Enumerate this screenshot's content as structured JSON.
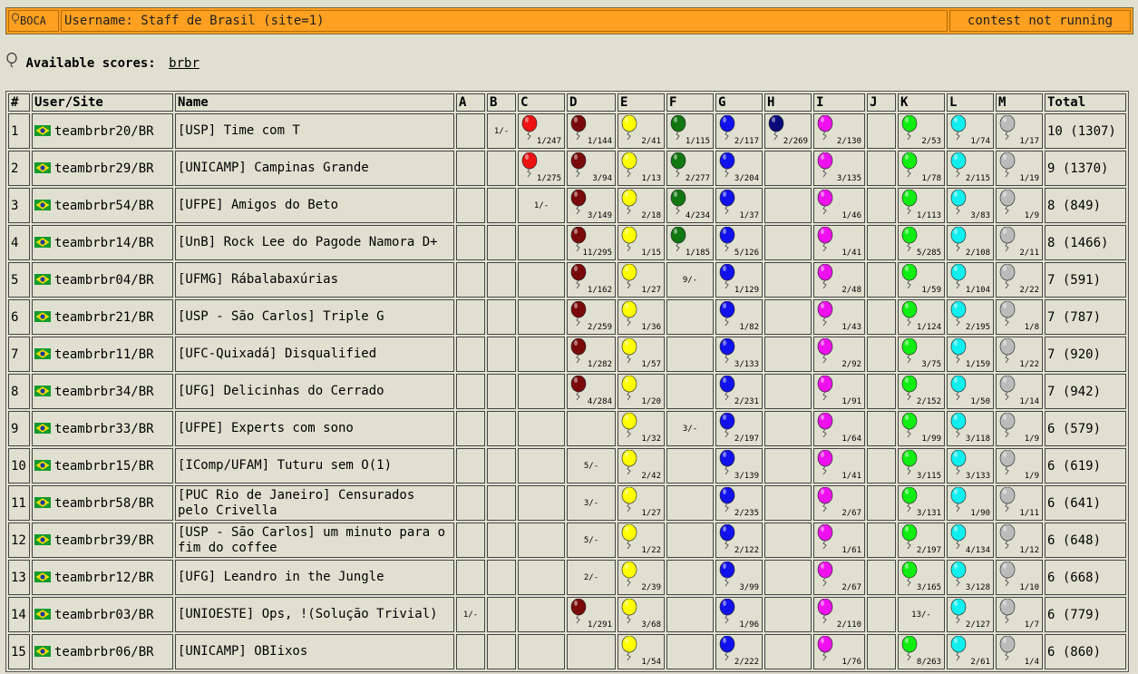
{
  "header": {
    "logo": "BOCA",
    "username": "Username: Staff de Brasil (site=1)",
    "status": "contest not running"
  },
  "scores": {
    "label": "Available scores:",
    "link": "brbr"
  },
  "columns": [
    "#",
    "User/Site",
    "Name",
    "A",
    "B",
    "C",
    "D",
    "E",
    "F",
    "G",
    "H",
    "I",
    "J",
    "K",
    "L",
    "M",
    "Total"
  ],
  "colors": {
    "C": "#ee1111",
    "D": "#7a0a0a",
    "E": "#ffff00",
    "F": "#117711",
    "G": "#1111ee",
    "H": "#0a0a7a",
    "I": "#ee11ee",
    "J": "#aaaaaa",
    "K": "#11ee11",
    "L": "#11eeee",
    "M": "#bbbbbb"
  },
  "rows": [
    {
      "rank": "1",
      "user": "teambrbr20/BR",
      "name": "[USP] Time com T",
      "cells": {
        "B": {
          "t": "1/-"
        },
        "C": {
          "v": "1/247"
        },
        "D": {
          "v": "1/144"
        },
        "E": {
          "v": "2/41"
        },
        "F": {
          "v": "1/115"
        },
        "G": {
          "v": "2/117"
        },
        "H": {
          "v": "2/269"
        },
        "I": {
          "v": "2/130"
        },
        "K": {
          "v": "2/53"
        },
        "L": {
          "v": "1/74"
        },
        "M": {
          "v": "1/17"
        }
      },
      "total": "10 (1307)"
    },
    {
      "rank": "2",
      "user": "teambrbr29/BR",
      "name": "[UNICAMP] Campinas Grande",
      "cells": {
        "C": {
          "v": "1/275"
        },
        "D": {
          "v": "3/94"
        },
        "E": {
          "v": "1/13"
        },
        "F": {
          "v": "2/277"
        },
        "G": {
          "v": "3/204"
        },
        "I": {
          "v": "3/135"
        },
        "K": {
          "v": "1/78"
        },
        "L": {
          "v": "2/115"
        },
        "M": {
          "v": "1/19"
        }
      },
      "total": "9 (1370)"
    },
    {
      "rank": "3",
      "user": "teambrbr54/BR",
      "name": "[UFPE] Amigos do Beto",
      "cells": {
        "C": {
          "t": "1/-"
        },
        "D": {
          "v": "3/149"
        },
        "E": {
          "v": "2/18"
        },
        "F": {
          "v": "4/234"
        },
        "G": {
          "v": "1/37"
        },
        "I": {
          "v": "1/46"
        },
        "K": {
          "v": "1/113"
        },
        "L": {
          "v": "3/83"
        },
        "M": {
          "v": "1/9"
        }
      },
      "total": "8 (849)"
    },
    {
      "rank": "4",
      "user": "teambrbr14/BR",
      "name": "[UnB] Rock Lee do Pagode Namora D+",
      "cells": {
        "D": {
          "v": "11/295"
        },
        "E": {
          "v": "1/15"
        },
        "F": {
          "v": "1/185"
        },
        "G": {
          "v": "5/126"
        },
        "I": {
          "v": "1/41"
        },
        "K": {
          "v": "5/285"
        },
        "L": {
          "v": "2/108"
        },
        "M": {
          "v": "2/11"
        }
      },
      "total": "8 (1466)"
    },
    {
      "rank": "5",
      "user": "teambrbr04/BR",
      "name": "[UFMG] Rábalabaxúrias",
      "cells": {
        "D": {
          "v": "1/162"
        },
        "E": {
          "v": "1/27"
        },
        "F": {
          "t": "9/-"
        },
        "G": {
          "v": "1/129"
        },
        "I": {
          "v": "2/48"
        },
        "K": {
          "v": "1/59"
        },
        "L": {
          "v": "1/104"
        },
        "M": {
          "v": "2/22"
        }
      },
      "total": "7 (591)"
    },
    {
      "rank": "6",
      "user": "teambrbr21/BR",
      "name": "[USP - São Carlos] Triple G",
      "cells": {
        "D": {
          "v": "2/259"
        },
        "E": {
          "v": "1/36"
        },
        "G": {
          "v": "1/82"
        },
        "I": {
          "v": "1/43"
        },
        "K": {
          "v": "1/124"
        },
        "L": {
          "v": "2/195"
        },
        "M": {
          "v": "1/8"
        }
      },
      "total": "7 (787)"
    },
    {
      "rank": "7",
      "user": "teambrbr11/BR",
      "name": "[UFC-Quixadá] Disqualified",
      "cells": {
        "D": {
          "v": "1/282"
        },
        "E": {
          "v": "1/57"
        },
        "G": {
          "v": "3/133"
        },
        "I": {
          "v": "2/92"
        },
        "K": {
          "v": "3/75"
        },
        "L": {
          "v": "1/159"
        },
        "M": {
          "v": "1/22"
        }
      },
      "total": "7 (920)"
    },
    {
      "rank": "8",
      "user": "teambrbr34/BR",
      "name": "[UFG] Delicinhas do Cerrado",
      "cells": {
        "D": {
          "v": "4/284"
        },
        "E": {
          "v": "1/20"
        },
        "G": {
          "v": "2/231"
        },
        "I": {
          "v": "1/91"
        },
        "K": {
          "v": "2/152"
        },
        "L": {
          "v": "1/50"
        },
        "M": {
          "v": "1/14"
        }
      },
      "total": "7 (942)"
    },
    {
      "rank": "9",
      "user": "teambrbr33/BR",
      "name": "[UFPE] Experts com sono",
      "cells": {
        "E": {
          "v": "1/32"
        },
        "F": {
          "t": "3/-"
        },
        "G": {
          "v": "2/197"
        },
        "I": {
          "v": "1/64"
        },
        "K": {
          "v": "1/99"
        },
        "L": {
          "v": "3/118"
        },
        "M": {
          "v": "1/9"
        }
      },
      "total": "6 (579)"
    },
    {
      "rank": "10",
      "user": "teambrbr15/BR",
      "name": "[IComp/UFAM] Tuturu sem O(1)",
      "cells": {
        "D": {
          "t": "5/-"
        },
        "E": {
          "v": "2/42"
        },
        "G": {
          "v": "3/139"
        },
        "I": {
          "v": "1/41"
        },
        "K": {
          "v": "3/115"
        },
        "L": {
          "v": "3/133"
        },
        "M": {
          "v": "1/9"
        }
      },
      "total": "6 (619)"
    },
    {
      "rank": "11",
      "user": "teambrbr58/BR",
      "name": "[PUC Rio de Janeiro] Censurados pelo Crivella",
      "cells": {
        "D": {
          "t": "3/-"
        },
        "E": {
          "v": "1/27"
        },
        "G": {
          "v": "2/235"
        },
        "I": {
          "v": "2/67"
        },
        "K": {
          "v": "3/131"
        },
        "L": {
          "v": "1/90"
        },
        "M": {
          "v": "1/11"
        }
      },
      "total": "6 (641)"
    },
    {
      "rank": "12",
      "user": "teambrbr39/BR",
      "name": "[USP - São Carlos] um minuto para o fim do coffee",
      "cells": {
        "D": {
          "t": "5/-"
        },
        "E": {
          "v": "1/22"
        },
        "G": {
          "v": "2/122"
        },
        "I": {
          "v": "1/61"
        },
        "K": {
          "v": "2/197"
        },
        "L": {
          "v": "4/134"
        },
        "M": {
          "v": "1/12"
        }
      },
      "total": "6 (648)"
    },
    {
      "rank": "13",
      "user": "teambrbr12/BR",
      "name": "[UFG] Leandro in the Jungle",
      "cells": {
        "D": {
          "t": "2/-"
        },
        "E": {
          "v": "2/39"
        },
        "G": {
          "v": "3/99"
        },
        "I": {
          "v": "2/67"
        },
        "K": {
          "v": "3/165"
        },
        "L": {
          "v": "3/128"
        },
        "M": {
          "v": "1/10"
        }
      },
      "total": "6 (668)"
    },
    {
      "rank": "14",
      "user": "teambrbr03/BR",
      "name": "[UNIOESTE] Ops, !(Solução Trivial)",
      "cells": {
        "A": {
          "t": "1/-"
        },
        "D": {
          "v": "1/291"
        },
        "E": {
          "v": "3/68"
        },
        "G": {
          "v": "1/96"
        },
        "I": {
          "v": "2/110"
        },
        "K": {
          "t": "13/-"
        },
        "L": {
          "v": "2/127"
        },
        "M": {
          "v": "1/7"
        }
      },
      "total": "6 (779)"
    },
    {
      "rank": "15",
      "user": "teambrbr06/BR",
      "name": "[UNICAMP] OBIixos",
      "cells": {
        "E": {
          "v": "1/54"
        },
        "G": {
          "v": "2/222"
        },
        "I": {
          "v": "1/76"
        },
        "K": {
          "v": "8/263"
        },
        "L": {
          "v": "2/61"
        },
        "M": {
          "v": "1/4"
        }
      },
      "total": "6 (860)"
    }
  ]
}
